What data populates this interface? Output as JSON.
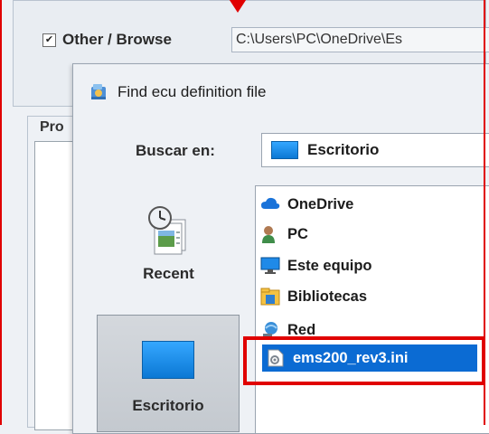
{
  "parent": {
    "other_checked": "✔",
    "other_label": "Other / Browse",
    "path_value": "C:\\Users\\PC\\OneDrive\\Es",
    "group_label": "Pro"
  },
  "dialog": {
    "title": "Find ecu definition file",
    "look_in_label": "Buscar en:",
    "look_in_value": "Escritorio",
    "places": [
      {
        "label": "Recent",
        "icon": "recent-icon"
      },
      {
        "label": "Escritorio",
        "icon": "desktop-icon"
      }
    ],
    "files": [
      {
        "name": "OneDrive",
        "icon": "cloud-icon"
      },
      {
        "name": "PC",
        "icon": "user-icon"
      },
      {
        "name": "Este equipo",
        "icon": "monitor-icon"
      },
      {
        "name": "Bibliotecas",
        "icon": "library-icon"
      },
      {
        "name": "Red",
        "icon": "network-icon"
      },
      {
        "name": "ems200_rev3.ini",
        "icon": "settings-file-icon",
        "selected": true
      }
    ]
  },
  "colors": {
    "highlight_red": "#e00000",
    "selection_blue": "#0b6bd3"
  }
}
